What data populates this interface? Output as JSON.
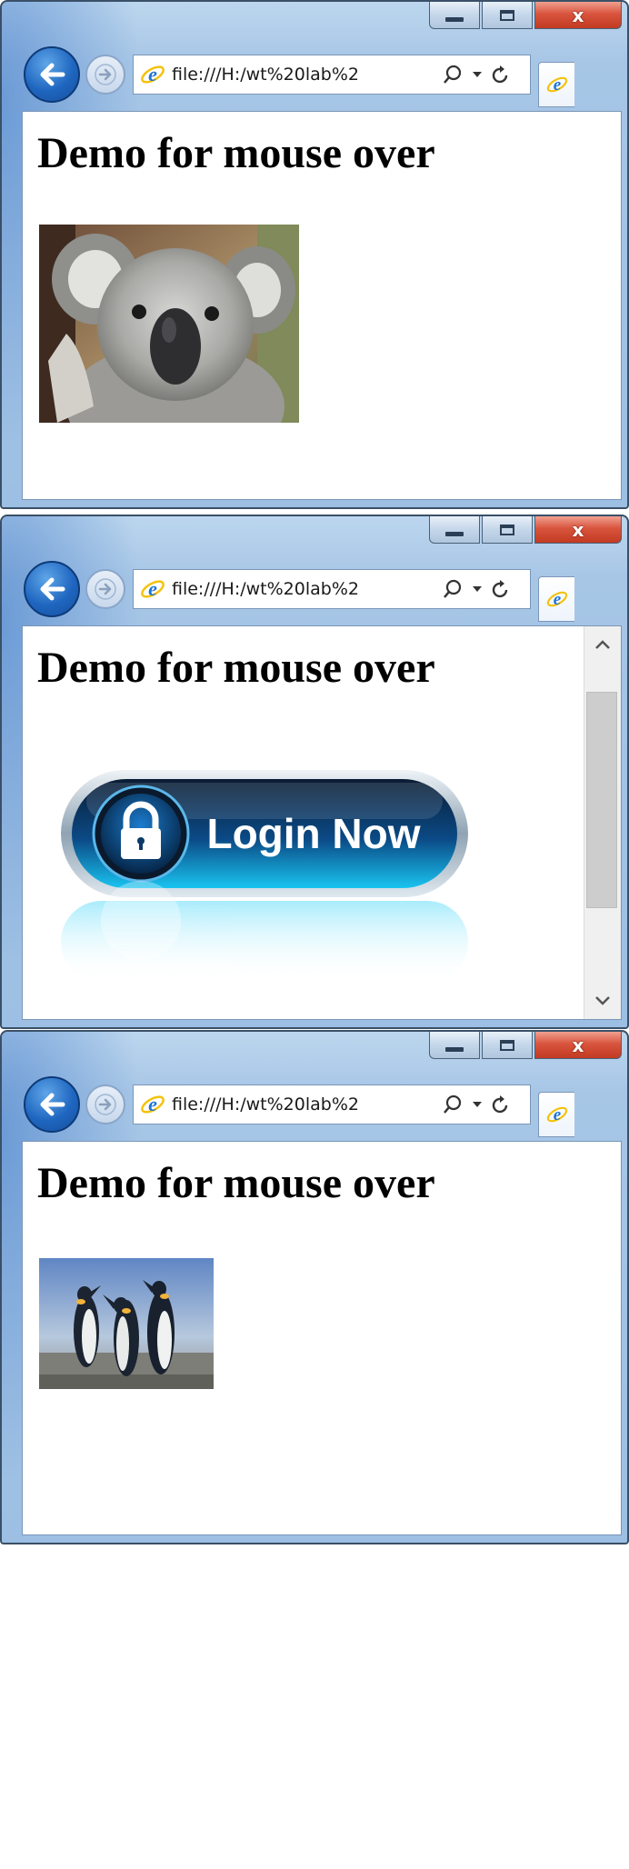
{
  "windows": [
    {
      "address": {
        "url": "file:///H:/wt%20lab%2"
      },
      "page": {
        "title": "Demo for mouse over"
      },
      "image": {
        "subject": "koala"
      }
    },
    {
      "address": {
        "url": "file:///H:/wt%20lab%2"
      },
      "page": {
        "title": "Demo for mouse over"
      },
      "image": {
        "subject": "login-button",
        "label": "Login Now"
      }
    },
    {
      "address": {
        "url": "file:///H:/wt%20lab%2"
      },
      "page": {
        "title": "Demo for mouse over"
      },
      "image": {
        "subject": "penguins"
      }
    }
  ],
  "caption_buttons": {
    "close_glyph": "x"
  },
  "icons": {
    "back": "back-arrow-icon",
    "forward": "forward-arrow-icon",
    "ie": "internet-explorer-icon",
    "search": "search-icon",
    "dropdown": "chevron-down-icon",
    "refresh": "refresh-icon",
    "scroll_up": "chevron-up-icon",
    "scroll_down": "chevron-down-icon"
  },
  "colors": {
    "chrome": "#a7c6e6",
    "close_button": "#c23a22",
    "back_button": "#1f66c0",
    "login_button": "#0a3a66",
    "login_glow": "#19c4f0"
  }
}
